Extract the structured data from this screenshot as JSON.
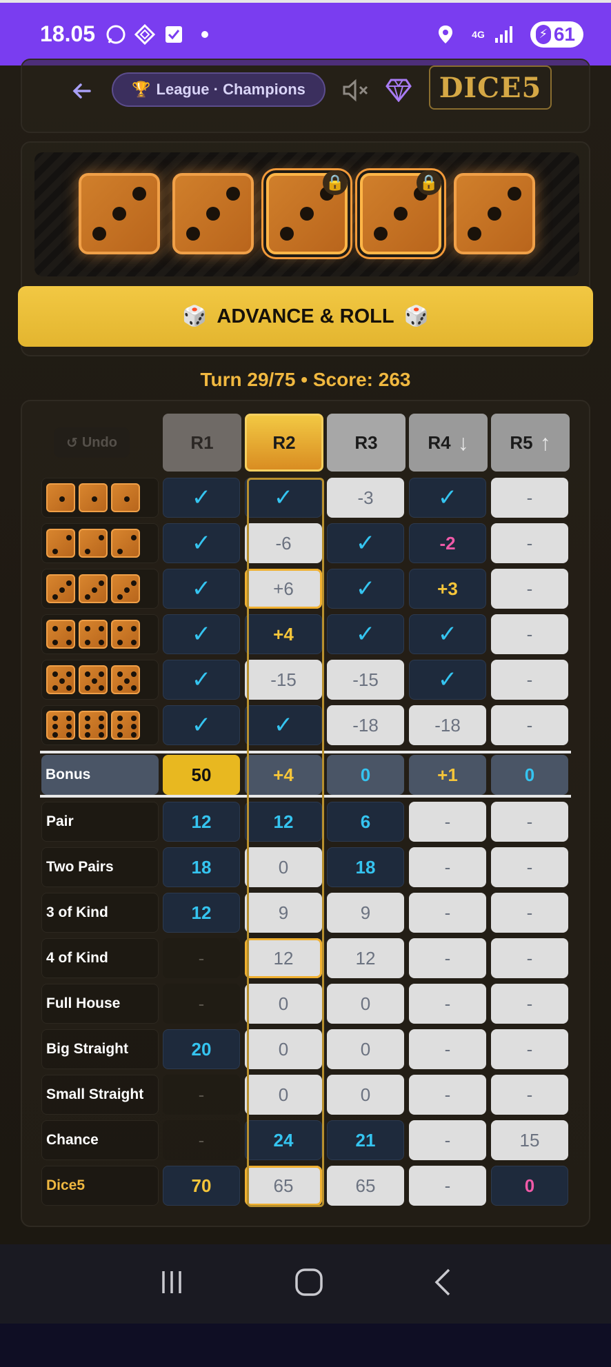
{
  "status_bar": {
    "time": "18.05",
    "network": "4G",
    "battery": "61"
  },
  "header": {
    "league_label": "League · Champions",
    "logo_text": "DICE5"
  },
  "dice": [
    {
      "value": 3,
      "locked": false
    },
    {
      "value": 3,
      "locked": false
    },
    {
      "value": 3,
      "locked": true
    },
    {
      "value": 3,
      "locked": true
    },
    {
      "value": 3,
      "locked": false
    }
  ],
  "roll_button": {
    "label": "ADVANCE & ROLL"
  },
  "turn_info": "Turn 29/75 • Score: 263",
  "table": {
    "undo_label": "Undo",
    "columns": [
      {
        "label": "R1",
        "arrow": ""
      },
      {
        "label": "R2",
        "arrow": ""
      },
      {
        "label": "R3",
        "arrow": ""
      },
      {
        "label": "R4",
        "arrow": "↓"
      },
      {
        "label": "R5",
        "arrow": "↑"
      }
    ],
    "active_column": "R2",
    "upper_rows": [
      {
        "face": 1,
        "cells": [
          "✓",
          "✓",
          "-3",
          "✓",
          "-"
        ]
      },
      {
        "face": 2,
        "cells": [
          "✓",
          "-6",
          "✓",
          "-2",
          "-"
        ]
      },
      {
        "face": 3,
        "cells": [
          "✓",
          "+6",
          "✓",
          "+3",
          "-"
        ]
      },
      {
        "face": 4,
        "cells": [
          "✓",
          "+4",
          "✓",
          "✓",
          "-"
        ]
      },
      {
        "face": 5,
        "cells": [
          "✓",
          "-15",
          "-15",
          "✓",
          "-"
        ]
      },
      {
        "face": 6,
        "cells": [
          "✓",
          "✓",
          "-18",
          "-18",
          "-"
        ]
      }
    ],
    "bonus": {
      "label": "Bonus",
      "cells": [
        "50",
        "+4",
        "0",
        "+1",
        "0"
      ]
    },
    "lower_rows": [
      {
        "label": "Pair",
        "cells": [
          "12",
          "12",
          "6",
          "-",
          "-"
        ]
      },
      {
        "label": "Two Pairs",
        "cells": [
          "18",
          "0",
          "18",
          "-",
          "-"
        ]
      },
      {
        "label": "3 of Kind",
        "cells": [
          "12",
          "9",
          "9",
          "-",
          "-"
        ]
      },
      {
        "label": "4 of Kind",
        "cells": [
          "-",
          "12",
          "12",
          "-",
          "-"
        ]
      },
      {
        "label": "Full House",
        "cells": [
          "-",
          "0",
          "0",
          "-",
          "-"
        ]
      },
      {
        "label": "Big Straight",
        "cells": [
          "20",
          "0",
          "0",
          "-",
          "-"
        ]
      },
      {
        "label": "Small Straight",
        "cells": [
          "-",
          "0",
          "0",
          "-",
          "-"
        ]
      },
      {
        "label": "Chance",
        "cells": [
          "-",
          "24",
          "21",
          "-",
          "15"
        ]
      },
      {
        "label": "Dice5",
        "cells": [
          "70",
          "65",
          "65",
          "-",
          "0"
        ]
      }
    ]
  },
  "colors": {
    "accent": "#f2c843",
    "status_bar": "#7a3df0",
    "cyan": "#35c4f0",
    "pink": "#f05aa8"
  }
}
